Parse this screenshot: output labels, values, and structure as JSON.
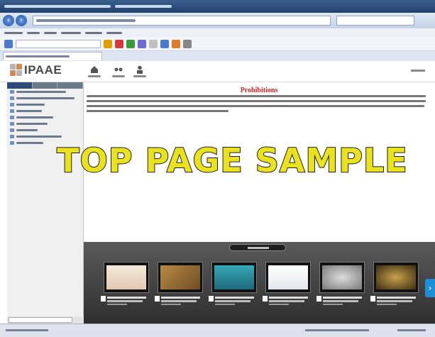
{
  "app": {
    "logo_text": "IPAAE"
  },
  "content": {
    "heading": "Prohibitions"
  },
  "overlay": {
    "text": "TOP PAGE SAMPLE"
  },
  "recent": {
    "thumbnails": [
      {
        "name": "thumb-1"
      },
      {
        "name": "thumb-2"
      },
      {
        "name": "thumb-3"
      },
      {
        "name": "thumb-4"
      },
      {
        "name": "thumb-5"
      },
      {
        "name": "thumb-6"
      }
    ]
  },
  "colors": {
    "heading_red": "#cc2222",
    "overlay_yellow": "#e9e21c",
    "sidebar_tab_active": "#2f4b7a",
    "next_arrow_blue": "#1d8fd8"
  },
  "icons": [
    "logo-icon",
    "home-icon",
    "share-icon",
    "user-icon",
    "folder-icon",
    "next-arrow-icon"
  ]
}
